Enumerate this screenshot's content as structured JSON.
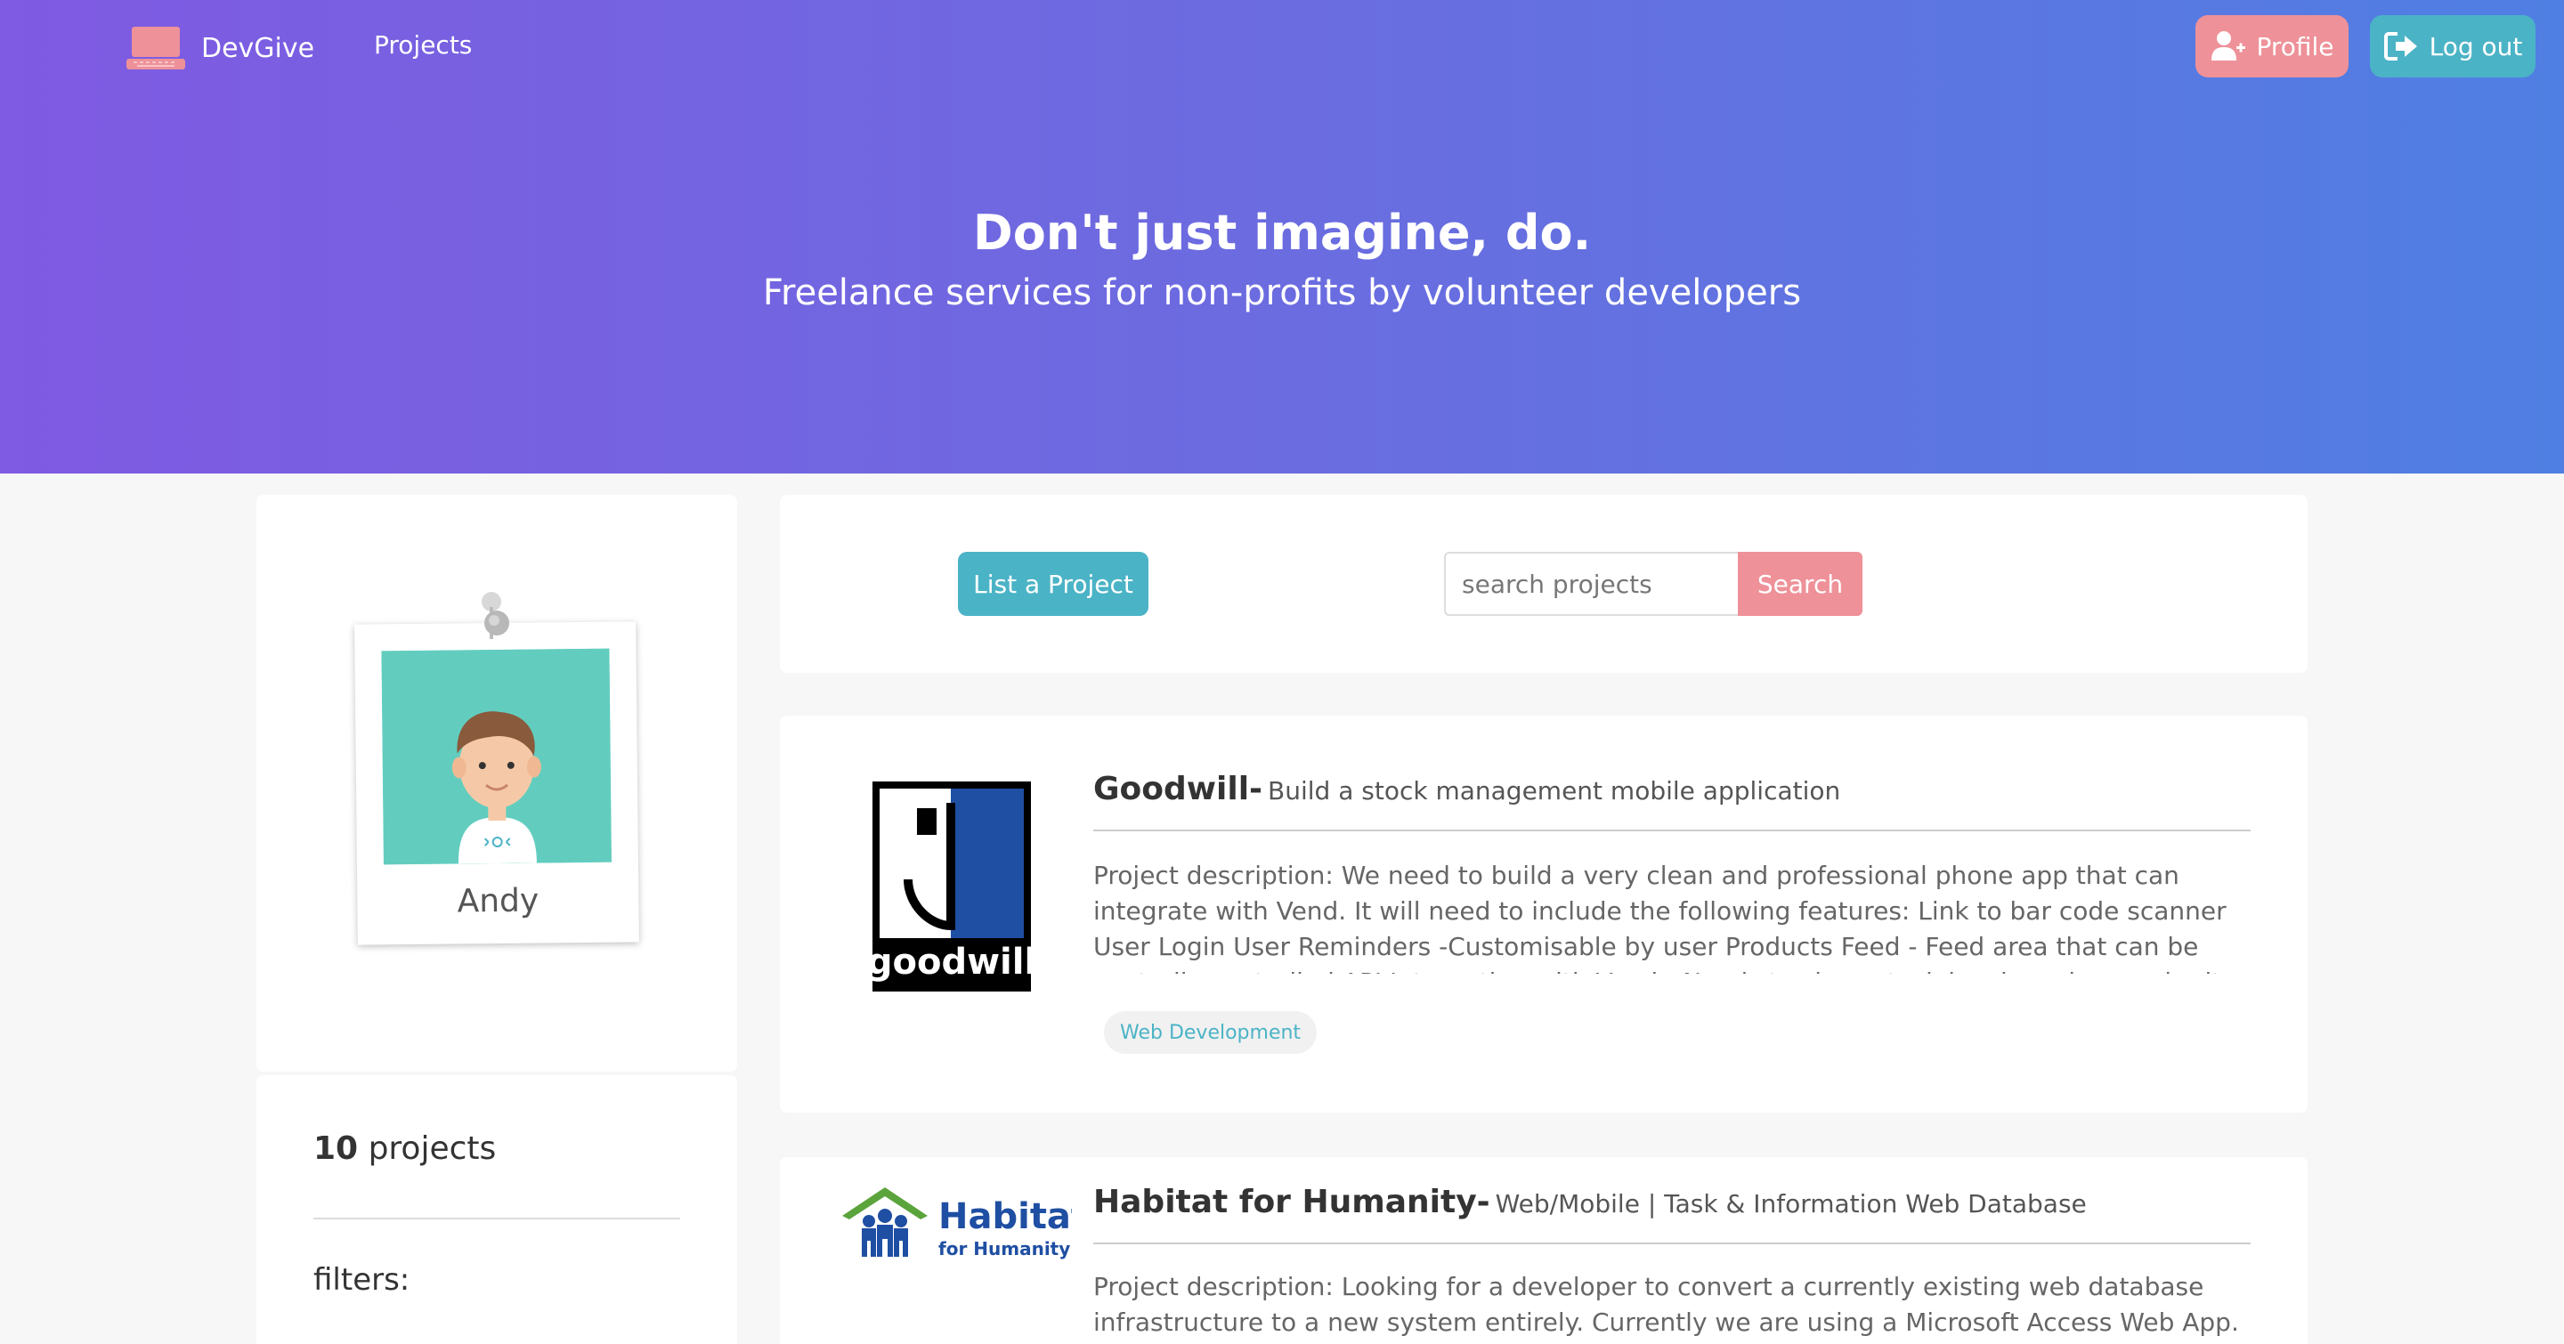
{
  "nav": {
    "brand": "DevGive",
    "projects_link": "Projects",
    "profile_button": "Profile",
    "logout_button": "Log out"
  },
  "hero": {
    "title": "Don't just imagine, do.",
    "subtitle": "Freelance services for non-profits by volunteer developers"
  },
  "profile": {
    "name": "Andy",
    "project_count": "10",
    "project_count_label": "projects",
    "filters_label": "filters:"
  },
  "toolbar": {
    "list_button": "List a Project",
    "search_placeholder": "search projects",
    "search_button": "Search"
  },
  "projects": [
    {
      "org": "Goodwill-",
      "summary": "Build a stock management mobile application",
      "description": "Project description: We need to build a very clean and professional phone app that can integrate with Vend. It will need to include the following features: Link to bar code scanner User Login User Reminders -Customisable by user Products Feed - Feed area that can be centrally controlled API Integration with Vend - Needs to show stock levels and can submit orders. User Reporting - Custom Dashboard with",
      "tag": "Web Development",
      "logo_text": "goodwill"
    },
    {
      "org": "Habitat for Humanity-",
      "summary": "Web/Mobile | Task & Information Web Database",
      "description": "Project description: Looking for a developer to convert a currently existing web database infrastructure to a new system entirely. Currently we are using a Microsoft Access Web App. These Web Apps will be",
      "logo_text_1": "Habitat",
      "logo_text_2": "for Humanity"
    }
  ],
  "colors": {
    "hero_start": "#7f5ae2",
    "hero_end": "#4f7fe2",
    "teal": "#4bb3c6",
    "pink": "#ee9199"
  }
}
